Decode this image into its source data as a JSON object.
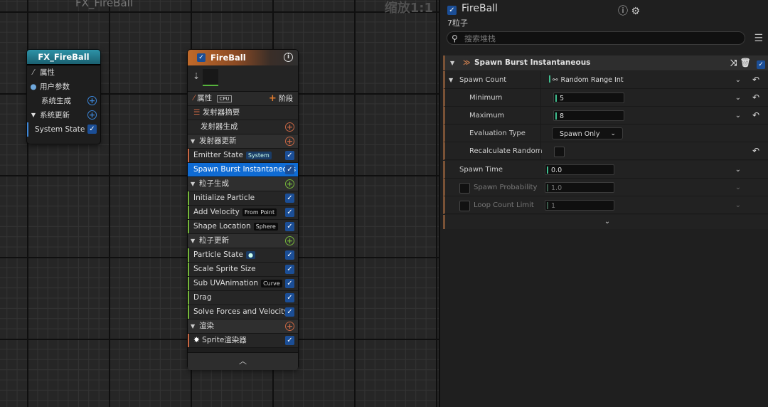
{
  "graph": {
    "title": "FX_FireBall",
    "zoom_label": "缩放1:1"
  },
  "system_node": {
    "title": "FX_FireBall",
    "rows": [
      {
        "label": "属性",
        "icon": "wand-icon"
      },
      {
        "label": "用户参数",
        "icon": "user-icon"
      },
      {
        "label": "系统生成",
        "icon": "add-circle-icon"
      },
      {
        "label": "系统更新",
        "icon": "add-circle-icon"
      },
      {
        "label": "System State",
        "icon": "checkbox-icon"
      }
    ]
  },
  "emitter_node": {
    "title": "FireBall",
    "properties_label": "属性",
    "cpu_badge": "CPU",
    "stage_label": "阶段",
    "emitter_summary": "发射器摘要",
    "emitter_spawn": "发射器生成",
    "emitter_update": "发射器更新",
    "emitter_state": {
      "label": "Emitter State",
      "tag": "System"
    },
    "spawn_burst": "Spawn Burst Instantaneous",
    "particle_spawn": "粒子生成",
    "initialize_particle": "Initialize Particle",
    "add_velocity": {
      "label": "Add Velocity",
      "tag": "From Point"
    },
    "shape_location": {
      "label": "Shape Location",
      "tag": "Sphere"
    },
    "particle_update": "粒子更新",
    "particle_state": {
      "label": "Particle State",
      "tag": "●"
    },
    "scale_sprite_size": "Scale Sprite Size",
    "sub_uv_animation": {
      "label": "Sub UVAnimation",
      "tag": "Curve"
    },
    "drag": "Drag",
    "solve_forces": "Solve Forces and Velocity",
    "render": "渲染",
    "sprite_renderer": "Sprite渲染器",
    "footer_icon": "chevron-up-icon"
  },
  "details": {
    "title": "FireBall",
    "particle_count": "7粒子",
    "search_placeholder": "搜索堆栈",
    "module_title": "Spawn Burst Instantaneous",
    "spawn_count": {
      "label": "Spawn Count",
      "mode": "Random Range Int"
    },
    "minimum": {
      "label": "Minimum",
      "value": "5"
    },
    "maximum": {
      "label": "Maximum",
      "value": "8"
    },
    "evaluation_type": {
      "label": "Evaluation Type",
      "value": "Spawn Only"
    },
    "recalculate_random": {
      "label": "Recalculate Random"
    },
    "spawn_time": {
      "label": "Spawn Time",
      "value": "0.0"
    },
    "spawn_probability": {
      "label": "Spawn Probability",
      "value": "1.0"
    },
    "loop_count_limit": {
      "label": "Loop Count Limit",
      "value": "1"
    }
  },
  "colors": {
    "selection": "#0f6bd3",
    "system_header": "#2d93a8",
    "emitter_header": "#c16a2a",
    "spawn_green": "#76b83a",
    "update_blue": "#3c86d8",
    "render_orange": "#c96744"
  }
}
